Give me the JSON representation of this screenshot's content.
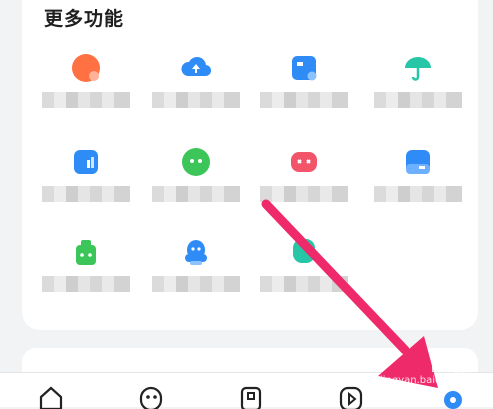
{
  "section": {
    "title": "更多功能"
  },
  "items": [
    {
      "name": "game-item",
      "icon": "game-icon",
      "color": "#ff7043"
    },
    {
      "name": "cloud-upload-item",
      "icon": "cloud-upload-icon",
      "color": "#2f8cf7"
    },
    {
      "name": "card-item",
      "icon": "card-icon",
      "color": "#2f8cf7"
    },
    {
      "name": "umbrella-item",
      "icon": "umbrella-icon",
      "color": "#26c6a6"
    },
    {
      "name": "data-item",
      "icon": "bar-chart-icon",
      "color": "#2f8cf7"
    },
    {
      "name": "wechat-item",
      "icon": "chat-bubble-icon",
      "color": "#3cc65a"
    },
    {
      "name": "gamepad-item",
      "icon": "gamepad-icon",
      "color": "#f2546a"
    },
    {
      "name": "info-item",
      "icon": "folder-icon",
      "color": "#2f8cf7"
    },
    {
      "name": "android-item",
      "icon": "android-icon",
      "color": "#3cc65a"
    },
    {
      "name": "qq-item",
      "icon": "qq-penguin-icon",
      "color": "#2f8cf7"
    },
    {
      "name": "green-app-item",
      "icon": "app-icon",
      "color": "#26c6a6"
    }
  ],
  "tabbar": {
    "tabs": [
      {
        "name": "home",
        "icon": "home-icon"
      },
      {
        "name": "discover",
        "icon": "face-icon"
      },
      {
        "name": "files",
        "icon": "file-icon"
      },
      {
        "name": "video",
        "icon": "play-icon"
      },
      {
        "name": "me",
        "icon": "profile-dot-icon"
      }
    ]
  },
  "watermark": {
    "text": "Bai 经验 jingyan.baidu.com"
  },
  "colors": {
    "accent": "#2f8cf7",
    "arrow": "#ee2a6b"
  }
}
